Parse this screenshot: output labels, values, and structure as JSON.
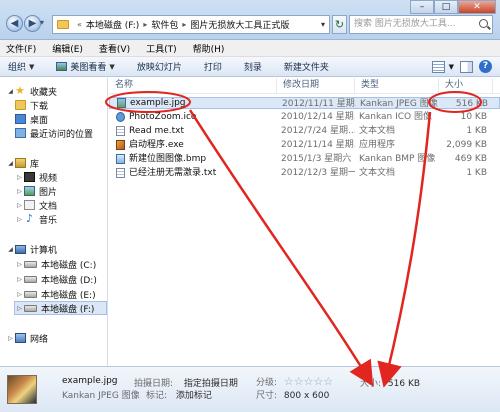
{
  "address_bar": {
    "crumbs": [
      "本地磁盘 (F:)",
      "软件包",
      "图片无损放大工具正式版"
    ],
    "search_placeholder": "搜索 图片无损放大工具..."
  },
  "menu": [
    "文件(F)",
    "编辑(E)",
    "查看(V)",
    "工具(T)",
    "帮助(H)"
  ],
  "toolbar": {
    "organize": "组织",
    "open_with": "美图看看",
    "slideshow": "放映幻灯片",
    "print": "打印",
    "burn": "刻录",
    "new_folder": "新建文件夹"
  },
  "nav": {
    "favorites": "收藏夹",
    "downloads": "下载",
    "desktop": "桌面",
    "recent": "最近访问的位置",
    "libraries": "库",
    "videos": "视频",
    "pictures": "图片",
    "documents": "文档",
    "music": "音乐",
    "computer": "计算机",
    "drive_c": "本地磁盘 (C:)",
    "drive_d": "本地磁盘 (D:)",
    "drive_e": "本地磁盘 (E:)",
    "drive_f": "本地磁盘 (F:)",
    "network": "网络"
  },
  "columns": {
    "name": "名称",
    "date": "修改日期",
    "type": "类型",
    "size": "大小"
  },
  "files": [
    {
      "name": "example.jpg",
      "date": "2012/11/11 星期...",
      "type": "Kankan JPEG 图像",
      "size": "516 KB",
      "icon": "jpg-icon"
    },
    {
      "name": "PhotoZoom.ico",
      "date": "2010/12/14 星期...",
      "type": "Kankan ICO 图像",
      "size": "10 KB",
      "icon": "ico-icon"
    },
    {
      "name": "Read me.txt",
      "date": "2012/7/24 星期...",
      "type": "文本文档",
      "size": "1 KB",
      "icon": "txt-icon"
    },
    {
      "name": "启动程序.exe",
      "date": "2012/11/14 星期...",
      "type": "应用程序",
      "size": "2,099 KB",
      "icon": "exe-icon"
    },
    {
      "name": "新建位图图像.bmp",
      "date": "2015/1/3 星期六 ...",
      "type": "Kankan BMP 图像",
      "size": "469 KB",
      "icon": "bmp-icon"
    },
    {
      "name": "已经注册无需激录.txt",
      "date": "2012/12/3 星期一...",
      "type": "文本文档",
      "size": "1 KB",
      "icon": "txt-icon"
    }
  ],
  "details": {
    "file_name": "example.jpg",
    "file_type": "Kankan JPEG 图像",
    "date_taken_label": "拍摄日期:",
    "date_taken_value": "指定拍摄日期",
    "tags_label": "标记:",
    "tags_value": "添加标记",
    "rating_label": "分级:",
    "rating_stars": "☆☆☆☆☆",
    "dimensions_label": "尺寸:",
    "dimensions_value": "800 x 600",
    "size_label": "大小:",
    "size_value": "516 KB"
  },
  "annotation_color": "#e0261f"
}
